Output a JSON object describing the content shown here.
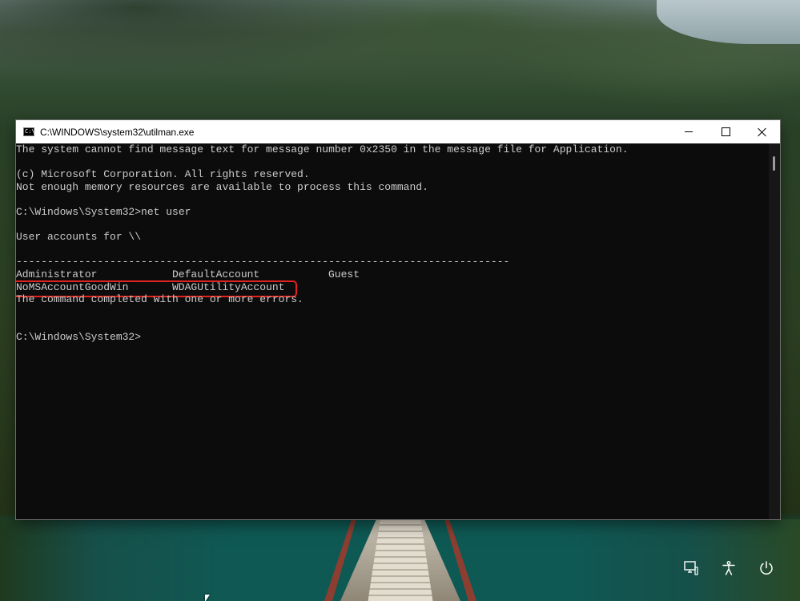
{
  "window": {
    "title": "C:\\WINDOWS\\system32\\utilman.exe",
    "icon_text": "C:\\"
  },
  "console": {
    "lines": [
      "The system cannot find message text for message number 0x2350 in the message file for Application.",
      "",
      "(c) Microsoft Corporation. All rights reserved.",
      "Not enough memory resources are available to process this command.",
      "",
      "C:\\Windows\\System32>net user",
      "",
      "User accounts for \\\\",
      "",
      "-------------------------------------------------------------------------------"
    ],
    "accounts_row1": [
      "Administrator",
      "DefaultAccount",
      "Guest"
    ],
    "accounts_row2": [
      "NoMSAccountGoodWin",
      "WDAGUtilityAccount"
    ],
    "completion": "The command completed with one or more errors.",
    "prompt": "C:\\Windows\\System32>"
  },
  "colors": {
    "console_bg": "#0c0c0c",
    "console_text": "#cccccc",
    "highlight": "#e0231e"
  },
  "icons": {
    "window": "cmd-icon",
    "minimize": "minimize-icon",
    "maximize": "maximize-icon",
    "close": "close-icon",
    "network": "network-icon",
    "accessibility": "accessibility-icon",
    "power": "power-icon"
  }
}
